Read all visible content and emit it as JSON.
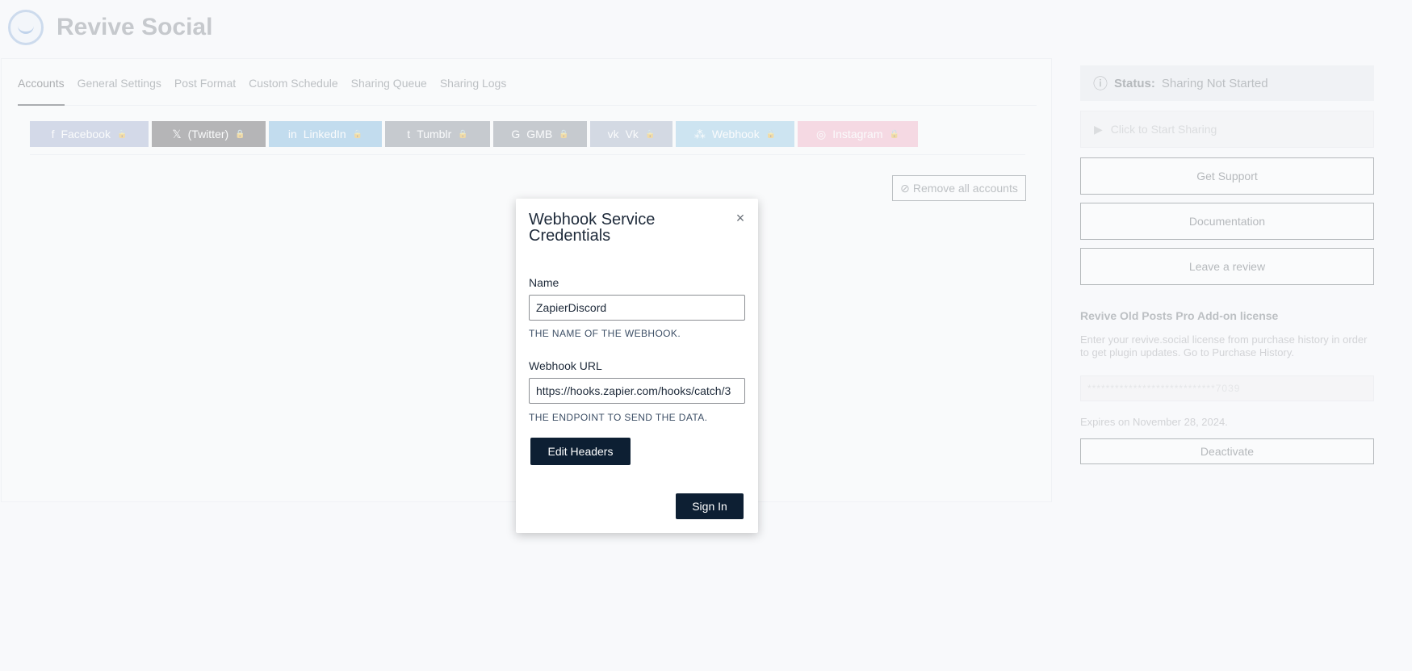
{
  "app": {
    "title": "Revive Social"
  },
  "tabs": [
    "Accounts",
    "General Settings",
    "Post Format",
    "Custom Schedule",
    "Sharing Queue",
    "Sharing Logs"
  ],
  "networks": [
    {
      "label": "Facebook",
      "icon": "f",
      "color": "#8f9fc6",
      "width": 147
    },
    {
      "label": "(Twitter)",
      "icon": "𝕏",
      "color": "#3a3a3a",
      "width": 141
    },
    {
      "label": "LinkedIn",
      "icon": "in",
      "color": "#5fa8d8",
      "width": 140
    },
    {
      "label": "Tumblr",
      "icon": "t",
      "color": "#6a7580",
      "width": 130
    },
    {
      "label": "GMB",
      "icon": "G",
      "color": "#6a7580",
      "width": 116
    },
    {
      "label": "Vk",
      "icon": "vk",
      "color": "#8fa0b8",
      "width": 102
    },
    {
      "label": "Webhook",
      "icon": "⁂",
      "color": "#7fc0e0",
      "width": 147
    },
    {
      "label": "Instagram",
      "icon": "◎",
      "color": "#f0a0b8",
      "width": 149
    }
  ],
  "remove_all": "Remove all accounts",
  "sidebar": {
    "status_label": "Status:",
    "status_value": "Sharing Not Started",
    "start": "Click to Start Sharing",
    "support": "Get Support",
    "docs": "Documentation",
    "review": "Leave a review",
    "license_title": "Revive Old Posts Pro Add-on license",
    "license_desc": "Enter your revive.social license from purchase history in order to get plugin updates. Go to Purchase History.",
    "license_value": "****************************7039",
    "expires": "Expires on November 28, 2024.",
    "deactivate": "Deactivate"
  },
  "modal": {
    "title": "Webhook Service Credentials",
    "close": "×",
    "name_label": "Name",
    "name_value": "ZapierDiscord",
    "name_help": "THE NAME OF THE WEBHOOK.",
    "url_label": "Webhook URL",
    "url_value": "https://hooks.zapier.com/hooks/catch/3",
    "url_help": "THE ENDPOINT TO SEND THE DATA.",
    "edit_headers": "Edit Headers",
    "sign_in": "Sign In"
  }
}
